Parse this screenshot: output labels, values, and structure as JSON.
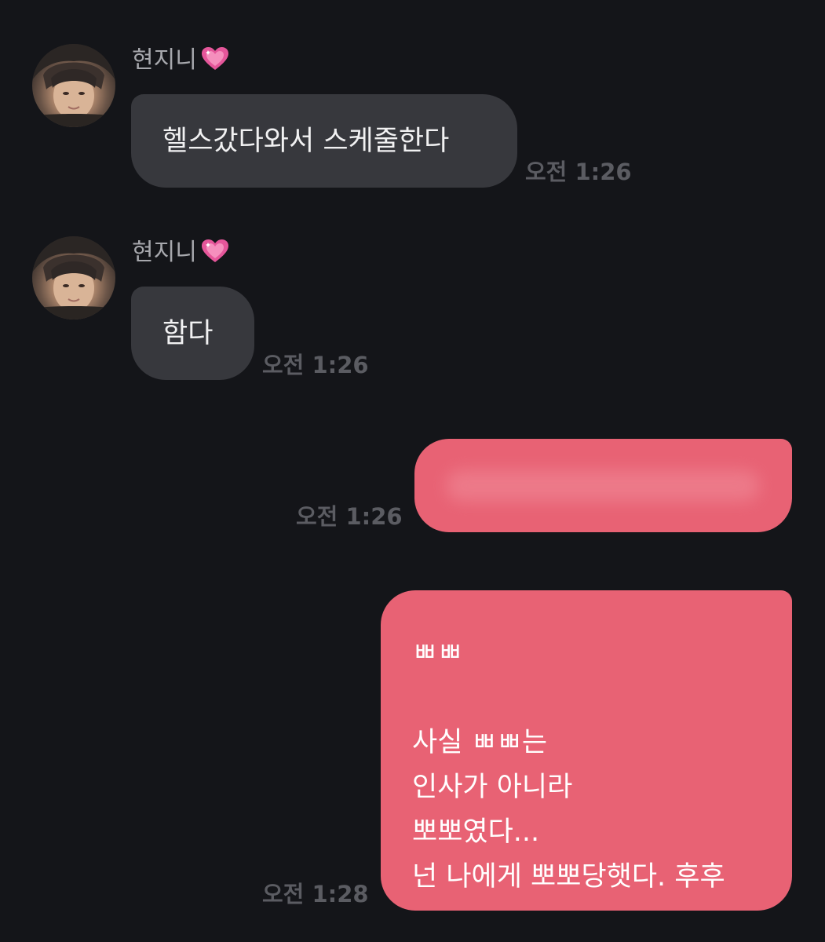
{
  "messages": [
    {
      "sender": "현지니",
      "text": "헬스갔다와서 스케줄한다",
      "time": "오전 1:26"
    },
    {
      "sender": "현지니",
      "text": "함다",
      "time": "오전 1:26"
    },
    {
      "outgoing_redacted": true,
      "time": "오전 1:26"
    },
    {
      "text": "ㅃㅃ\n\n사실 ㅃㅃ는\n인사가 아니라\n뽀뽀였다...\n넌 나에게 뽀뽀당햇다. 후후",
      "time": "오전 1:28"
    }
  ],
  "icons": {
    "heart": "sparkling-heart-icon"
  },
  "colors": {
    "background": "#141519",
    "incoming_bubble": "#37383d",
    "outgoing_bubble": "#e86274",
    "timestamp": "#5b5c62",
    "sender_name": "#a7a8ad"
  }
}
